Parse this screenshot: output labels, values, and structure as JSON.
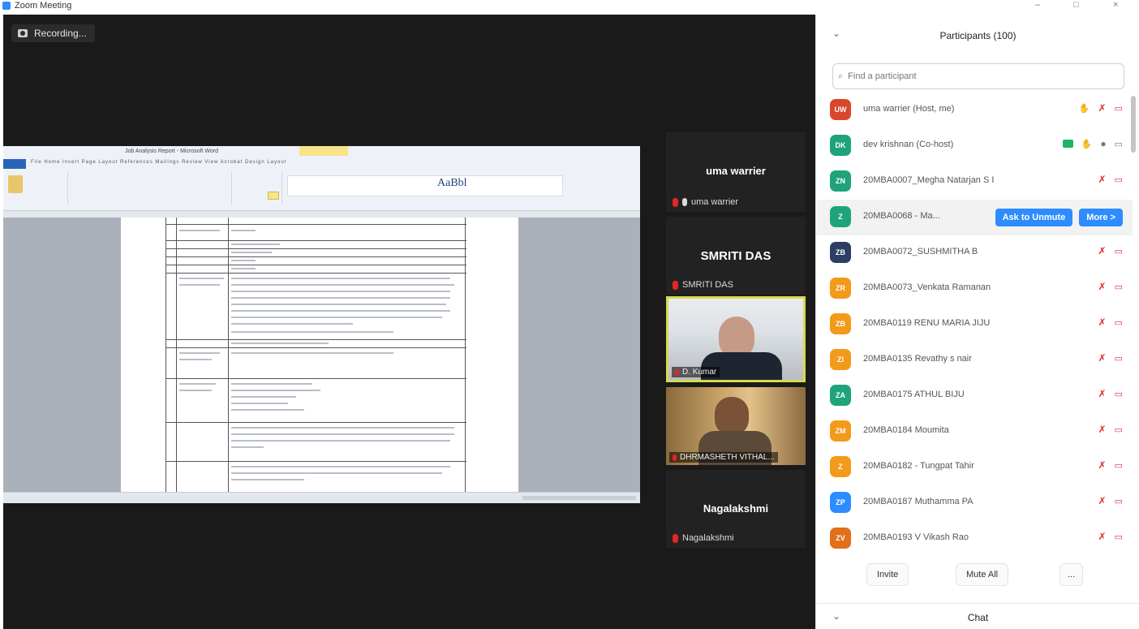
{
  "window": {
    "title": "Zoom Meeting",
    "minimize": "–",
    "maximize": "□",
    "close": "×"
  },
  "recording": {
    "label": "Recording..."
  },
  "shared_screen": {
    "app_title": "Job Analysis Report - Microsoft Word",
    "ribbon_tabs": "File  Home  Insert  Page Layout  References  Mailings  Review  View  Acrobat  Design  Layout",
    "style_sample": "AaBbl"
  },
  "gallery": {
    "tiles": [
      {
        "big": "uma warrier",
        "name": "uma warrier"
      },
      {
        "big": "SMRITI DAS",
        "name": "SMRITI DAS"
      },
      {
        "name": "D. Kumar"
      },
      {
        "name": "DHRMASHETH VITHAL..."
      },
      {
        "big": "Nagalakshmi",
        "name": "Nagalakshmi"
      }
    ]
  },
  "participants": {
    "title": "Participants (100)",
    "collapse_icon": "⌄",
    "search_placeholder": "Find a participant",
    "ask_to_unmute": "Ask to Unmute",
    "more": "More >",
    "list": [
      {
        "initials": "UW",
        "color": "#d9482b",
        "name": "uma warrier (Host, me)"
      },
      {
        "initials": "DK",
        "color": "#1fa37a",
        "name": "dev krishnan (Co-host)"
      },
      {
        "initials": "ZN",
        "color": "#1fa37a",
        "name": "20MBA0007_Megha Natarjan S I"
      },
      {
        "initials": "Z",
        "color": "#1fa37a",
        "name": "20MBA0068 - Ma..."
      },
      {
        "initials": "ZB",
        "color": "#2a3f63",
        "name": "20MBA0072_SUSHMITHA B"
      },
      {
        "initials": "ZR",
        "color": "#f39a1a",
        "name": "20MBA0073_Venkata Ramanan"
      },
      {
        "initials": "ZB",
        "color": "#f39a1a",
        "name": "20MBA0119 RENU MARIA JIJU"
      },
      {
        "initials": "ZI",
        "color": "#f39a1a",
        "name": "20MBA0135 Revathy s nair"
      },
      {
        "initials": "ZA",
        "color": "#1fa37a",
        "name": "20MBA0175 ATHUL BIJU"
      },
      {
        "initials": "ZM",
        "color": "#f39a1a",
        "name": "20MBA0184 Moumita"
      },
      {
        "initials": "Z",
        "color": "#f39a1a",
        "name": "20MBA0182 - Tungpat Tahir"
      },
      {
        "initials": "ZP",
        "color": "#2d8cff",
        "name": "20MBA0187 Muthamma PA"
      },
      {
        "initials": "ZV",
        "color": "#e0701a",
        "name": "20MBA0193 V Vikash Rao"
      }
    ],
    "footer": {
      "invite": "Invite",
      "mute_all": "Mute All",
      "more": "..."
    }
  },
  "chat": {
    "title": "Chat",
    "collapse_icon": "⌄"
  }
}
